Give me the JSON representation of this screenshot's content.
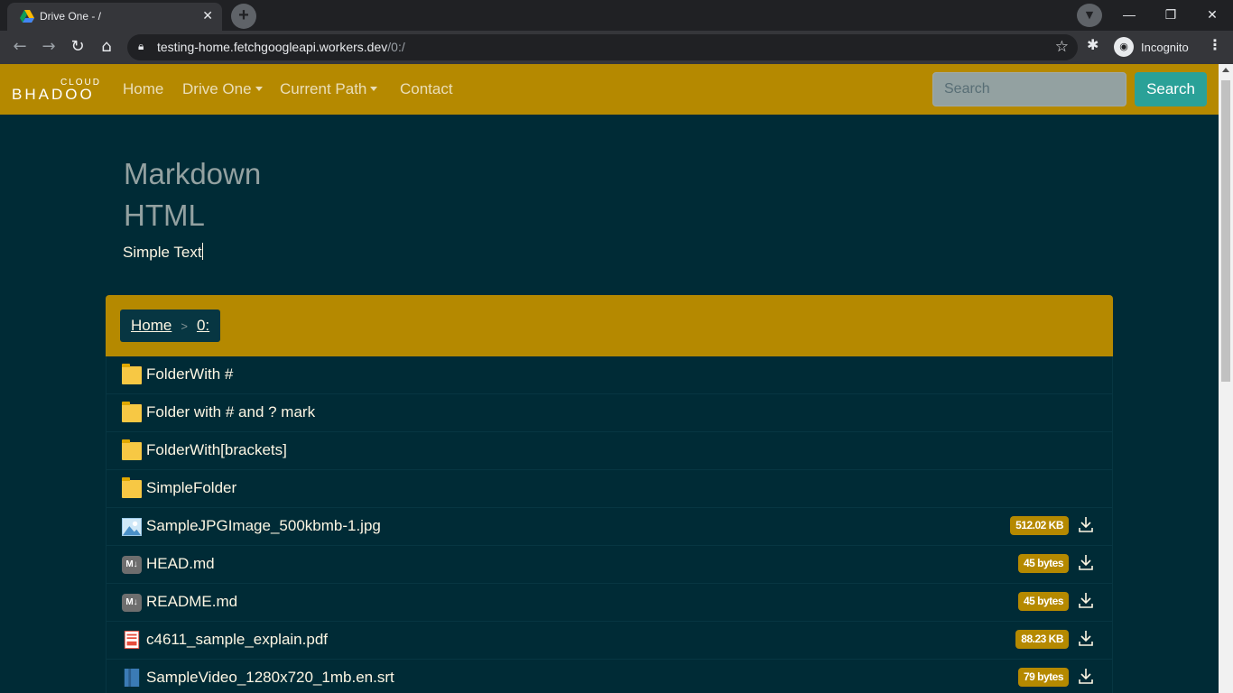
{
  "browser": {
    "tab_title": "Drive One - /",
    "url_host": "testing-home.fetchgoogleapi.workers.dev",
    "url_path": "/0:/",
    "incognito_label": "Incognito"
  },
  "navbar": {
    "logo_top": "CLOUD",
    "logo_brand": "BHADOO",
    "links": [
      "Home",
      "Drive One",
      "Current Path",
      "Contact"
    ],
    "search_placeholder": "Search",
    "search_button": "Search"
  },
  "readme": {
    "h1": "Markdown",
    "h2": "HTML",
    "text": "Simple Text"
  },
  "breadcrumb": {
    "home": "Home",
    "separator": ">",
    "current": "0:"
  },
  "files": [
    {
      "name": "FolderWith #",
      "type": "folder-icon"
    },
    {
      "name": "Folder with # and ? mark",
      "type": "folder-icon"
    },
    {
      "name": "FolderWith[brackets]",
      "type": "folder-icon"
    },
    {
      "name": "SimpleFolder",
      "type": "folder-icon"
    },
    {
      "name": "SampleJPGImage_500kbmb-1.jpg",
      "type": "image-icon",
      "size": "512.02 KB"
    },
    {
      "name": "HEAD.md",
      "type": "markdown-icon",
      "size": "45 bytes"
    },
    {
      "name": "README.md",
      "type": "markdown-icon",
      "size": "45 bytes"
    },
    {
      "name": "c4611_sample_explain.pdf",
      "type": "pdf-icon",
      "size": "88.23 KB"
    },
    {
      "name": "SampleVideo_1280x720_1mb.en.srt",
      "type": "text-file-icon",
      "size": "79 bytes"
    }
  ],
  "colors": {
    "navbar": "#b58900",
    "background": "#002b36",
    "search_button": "#2aa198"
  }
}
